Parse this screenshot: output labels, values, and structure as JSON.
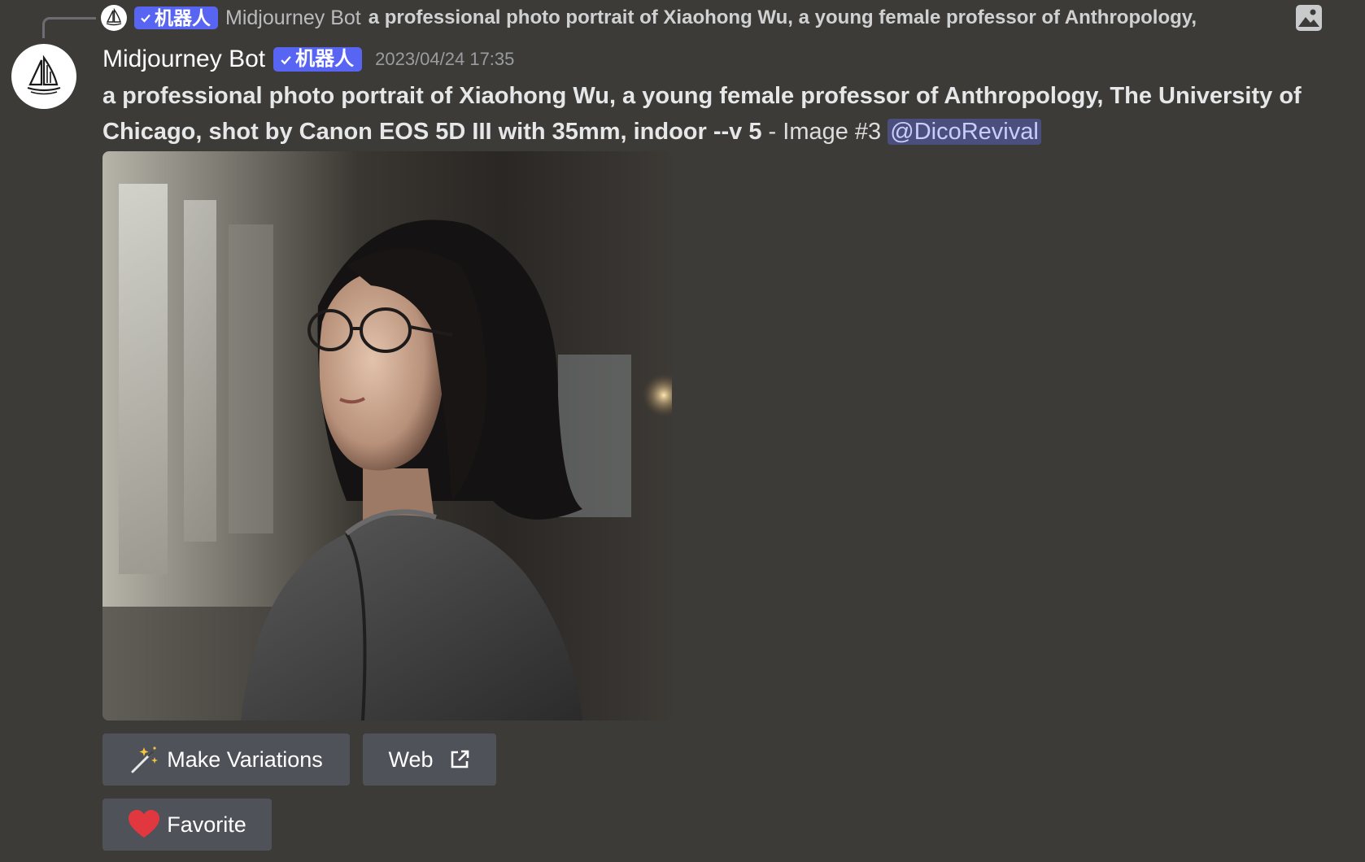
{
  "reply": {
    "badge_label": "机器人",
    "author": "Midjourney Bot",
    "text": "a professional photo portrait of Xiaohong Wu, a young female professor of Anthropology,"
  },
  "message": {
    "author": "Midjourney Bot",
    "badge_label": "机器人",
    "timestamp": "2023/04/24 17:35",
    "prompt": "a professional photo portrait of Xiaohong Wu, a young female professor of Anthropology, The University of Chicago, shot by Canon EOS 5D III with 35mm, indoor --v 5",
    "suffix": " - Image #3 ",
    "mention": "@DicoRevival"
  },
  "buttons": {
    "variations_label": "Make Variations",
    "web_label": "Web",
    "favorite_label": "Favorite"
  },
  "colors": {
    "background": "#3c3b37",
    "badge": "#5865f2",
    "button": "#4f5258",
    "mention_bg": "#4a4f7e",
    "heart": "#e0383e"
  }
}
